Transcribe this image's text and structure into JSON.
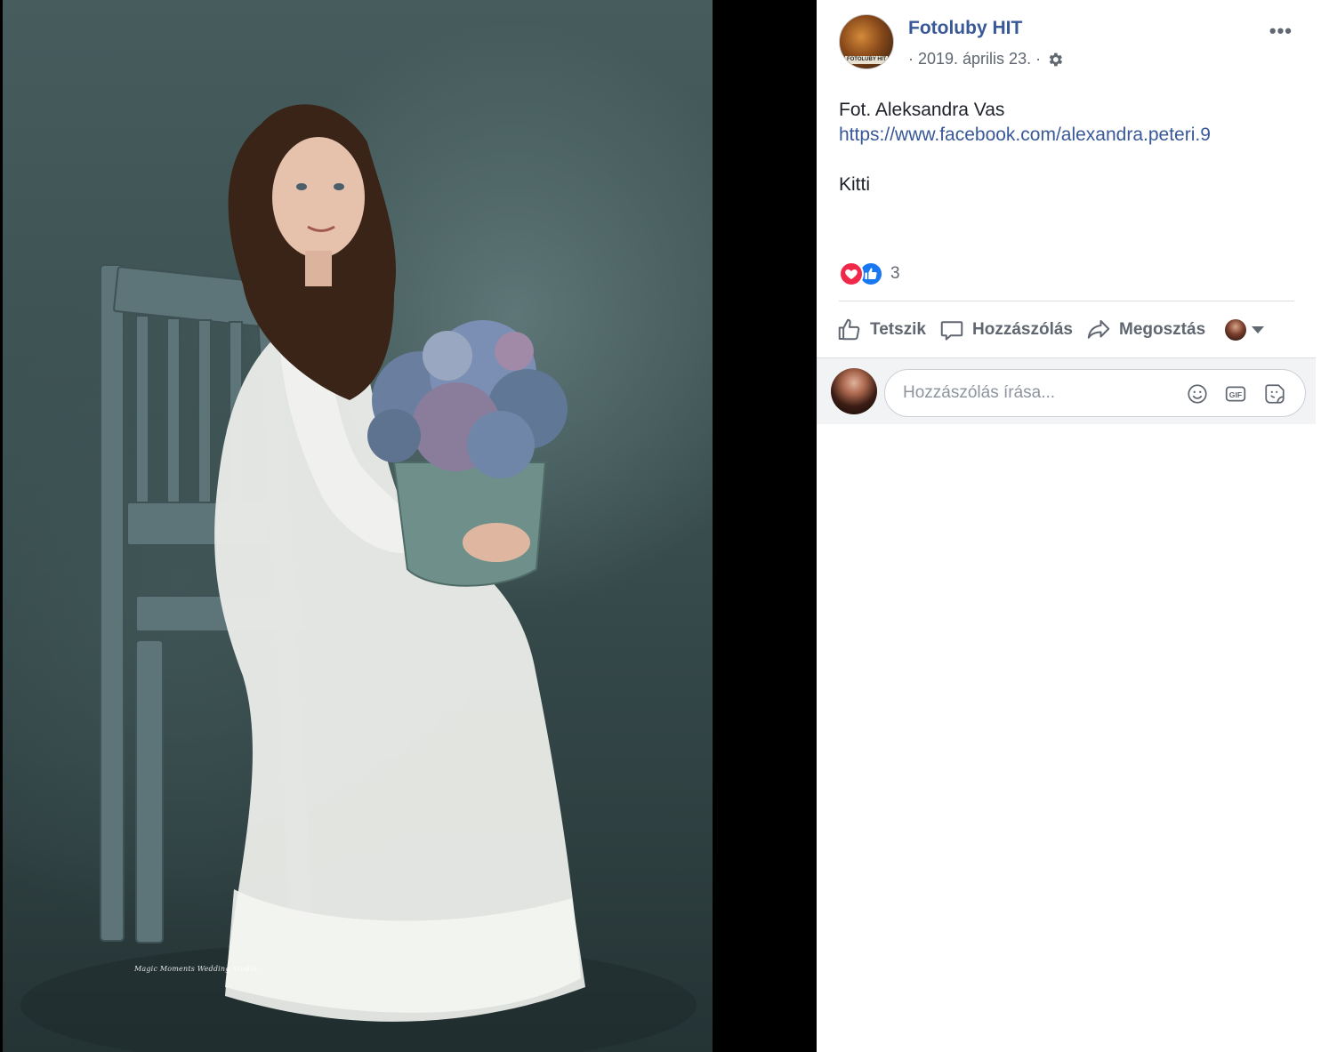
{
  "post": {
    "page_name": "Fotoluby HIT",
    "page_avatar_label": "FOTOLUBY HIT",
    "date": "· 2019. április 23. ·",
    "more_label": "•••",
    "text_line1": "Fot. Aleksandra Vas",
    "link": "https://www.facebook.com/alexandra.peteri.9",
    "text_line2": "Kitti"
  },
  "reactions": {
    "types": [
      "love-icon",
      "like-icon"
    ],
    "count": "3"
  },
  "actions": {
    "like_label": "Tetszik",
    "comment_label": "Hozzászólás",
    "share_label": "Megosztás"
  },
  "comment": {
    "placeholder": "Hozzászólás írása..."
  },
  "photo": {
    "watermark": "Magic Moments Wedding Studio"
  },
  "colors": {
    "link": "#385898",
    "muted": "#606770",
    "love": "#f0284a",
    "like": "#1877f2"
  }
}
